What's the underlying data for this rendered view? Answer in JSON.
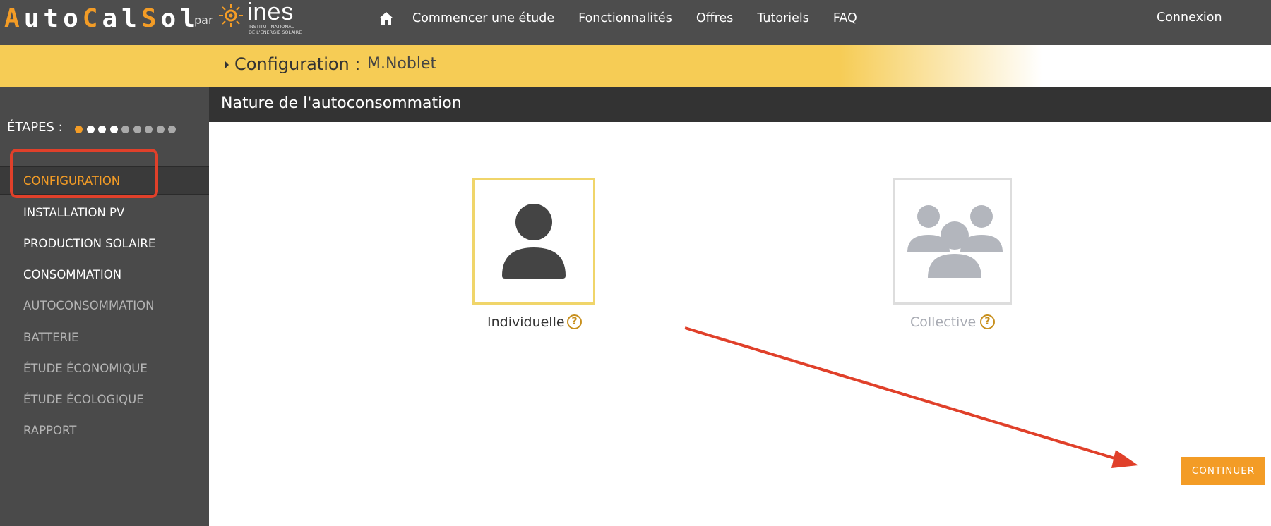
{
  "brand": {
    "letters": [
      {
        "ch": "A",
        "color": "#f39c26"
      },
      {
        "ch": "u",
        "color": "#ffffff"
      },
      {
        "ch": "t",
        "color": "#ffffff"
      },
      {
        "ch": "o",
        "color": "#ffffff"
      },
      {
        "ch": "C",
        "color": "#f39c26"
      },
      {
        "ch": "a",
        "color": "#ffffff"
      },
      {
        "ch": "l",
        "color": "#ffffff"
      },
      {
        "ch": "S",
        "color": "#f39c26"
      },
      {
        "ch": "o",
        "color": "#ffffff"
      },
      {
        "ch": "l",
        "color": "#ffffff"
      }
    ],
    "par": "par",
    "partner": "ines",
    "partner_sub_1": "INSTITUT NATIONAL",
    "partner_sub_2": "DE L'ENERGIE SOLAIRE"
  },
  "nav": {
    "home_icon": "home-icon",
    "links": [
      "Commencer une étude",
      "Fonctionnalités",
      "Offres",
      "Tutoriels",
      "FAQ"
    ],
    "login": "Connexion"
  },
  "band": {
    "label": "Configuration :",
    "name": "M.Noblet"
  },
  "sidebar": {
    "etapes_label": "ÉTAPES :",
    "dots": [
      "#f39c26",
      "#ffffff",
      "#ffffff",
      "#ffffff",
      "#aaaaaa",
      "#aaaaaa",
      "#aaaaaa",
      "#aaaaaa",
      "#aaaaaa"
    ],
    "items": [
      {
        "label": "CONFIGURATION",
        "state": "active",
        "color": "#f39c26"
      },
      {
        "label": "INSTALLATION PV",
        "state": "enabled",
        "color": "#ffffff"
      },
      {
        "label": "PRODUCTION SOLAIRE",
        "state": "enabled",
        "color": "#ffffff"
      },
      {
        "label": "CONSOMMATION",
        "state": "enabled",
        "color": "#ffffff"
      },
      {
        "label": "AUTOCONSOMMATION",
        "state": "disabled",
        "color": "#b5b5b5"
      },
      {
        "label": "BATTERIE",
        "state": "disabled",
        "color": "#b5b5b5"
      },
      {
        "label": "ÉTUDE ÉCONOMIQUE",
        "state": "disabled",
        "color": "#b5b5b5"
      },
      {
        "label": "ÉTUDE ÉCOLOGIQUE",
        "state": "disabled",
        "color": "#b5b5b5"
      },
      {
        "label": "RAPPORT",
        "state": "disabled",
        "color": "#b5b5b5"
      }
    ]
  },
  "main": {
    "title": "Nature de l'autoconsommation",
    "options": [
      {
        "label": "Individuelle",
        "icon": "single-person-icon",
        "selected": true
      },
      {
        "label": "Collective",
        "icon": "group-people-icon",
        "selected": false
      }
    ],
    "help_glyph": "?",
    "continue_label": "CONTINUER"
  },
  "colors": {
    "accent": "#f39c26",
    "band": "#f6cc55",
    "annotation": "#e0402a"
  }
}
